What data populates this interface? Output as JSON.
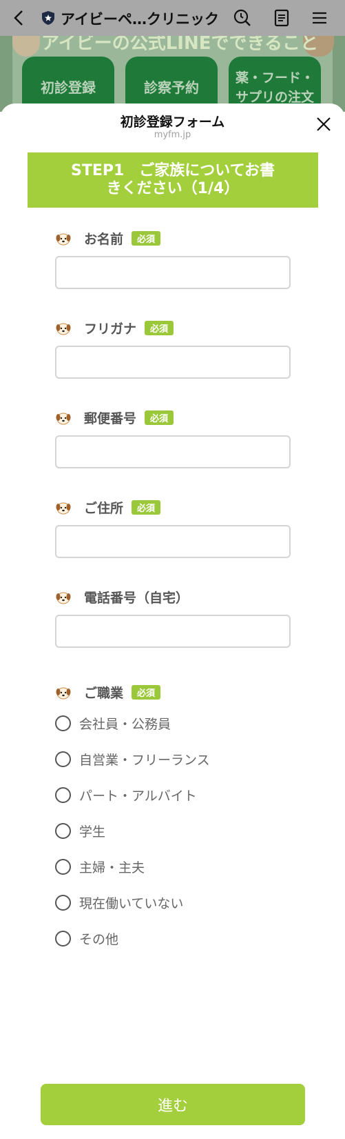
{
  "browser": {
    "title": "アイビーペ…クリニック"
  },
  "background": {
    "banner_text": "アイビーの公式LINEでできること",
    "buttons": [
      {
        "label": "初診登録"
      },
      {
        "label": "診察予約"
      },
      {
        "label": "薬・フード・\nサプリの注文"
      }
    ]
  },
  "sheet": {
    "title": "初診登録フォーム",
    "domain": "myfm.jp",
    "step": "STEP1　ご家族についてお書\nきください（1/4）"
  },
  "form": {
    "required_badge": "必須",
    "fields": [
      {
        "label": "お名前",
        "required": true,
        "value": ""
      },
      {
        "label": "フリガナ",
        "required": true,
        "value": ""
      },
      {
        "label": "郵便番号",
        "required": true,
        "value": ""
      },
      {
        "label": "ご住所",
        "required": true,
        "value": ""
      },
      {
        "label": "電話番号（自宅）",
        "required": false,
        "value": ""
      }
    ],
    "occupation": {
      "label": "ご職業",
      "required": true,
      "options": [
        "会社員・公務員",
        "自営業・フリーランス",
        "パート・アルバイト",
        "学生",
        "主婦・主夫",
        "現在働いていない",
        "その他"
      ]
    },
    "submit_label": "進む"
  },
  "icons": [
    "back-icon",
    "shield-icon",
    "search-history-icon",
    "document-icon",
    "menu-icon",
    "close-icon",
    "dog-icon"
  ],
  "colors": {
    "accent": "#a3cf3c",
    "badge": "#9ac83a",
    "topbar": "#a8a8a8"
  }
}
